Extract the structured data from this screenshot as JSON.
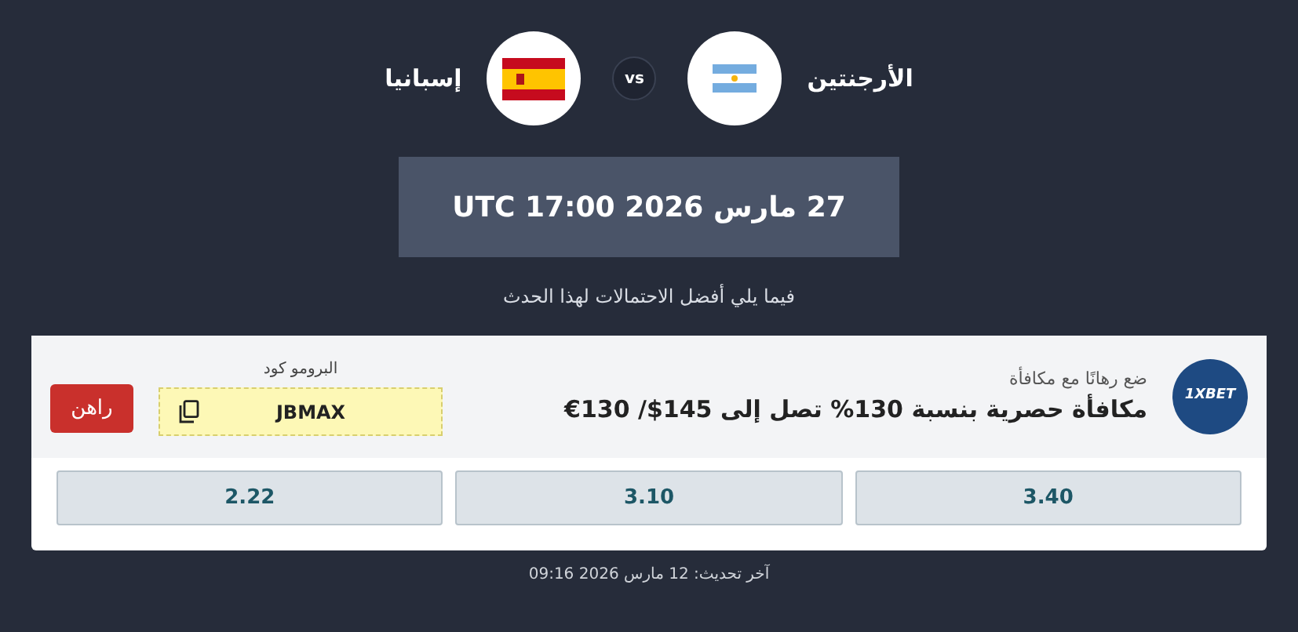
{
  "match": {
    "home": {
      "name": "الأرجنتين"
    },
    "vs": "vs",
    "away": {
      "name": "إسبانيا"
    }
  },
  "date": "27 مارس 2026 17:00 UTC",
  "subtitle": "فيما يلي أفضل الاحتمالات لهذا الحدث",
  "offer": {
    "logo": "1XBET",
    "tagline": "ضع رهانًا مع مكافأة",
    "title": "مكافأة حصرية بنسبة 130% تصل إلى 145$/ 130€",
    "promo_label": "البرومو كود",
    "promo_code": "JBMAX",
    "bet_button": "راهن"
  },
  "odds": [
    "3.40",
    "3.10",
    "2.22"
  ],
  "updated": "آخر تحديث: 12 مارس 2026 09:16"
}
